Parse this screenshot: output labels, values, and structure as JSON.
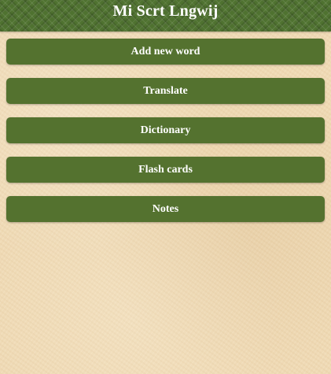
{
  "header": {
    "title": "Mi Scrt Lngwij"
  },
  "menu": {
    "items": [
      {
        "label": "Add new word"
      },
      {
        "label": "Translate"
      },
      {
        "label": "Dictionary"
      },
      {
        "label": "Flash cards"
      },
      {
        "label": "Notes"
      }
    ]
  },
  "colors": {
    "header_background": "#4f7230",
    "button_background": "#54722f",
    "page_background": "#f1dcb7",
    "text_light": "#ffffff"
  }
}
